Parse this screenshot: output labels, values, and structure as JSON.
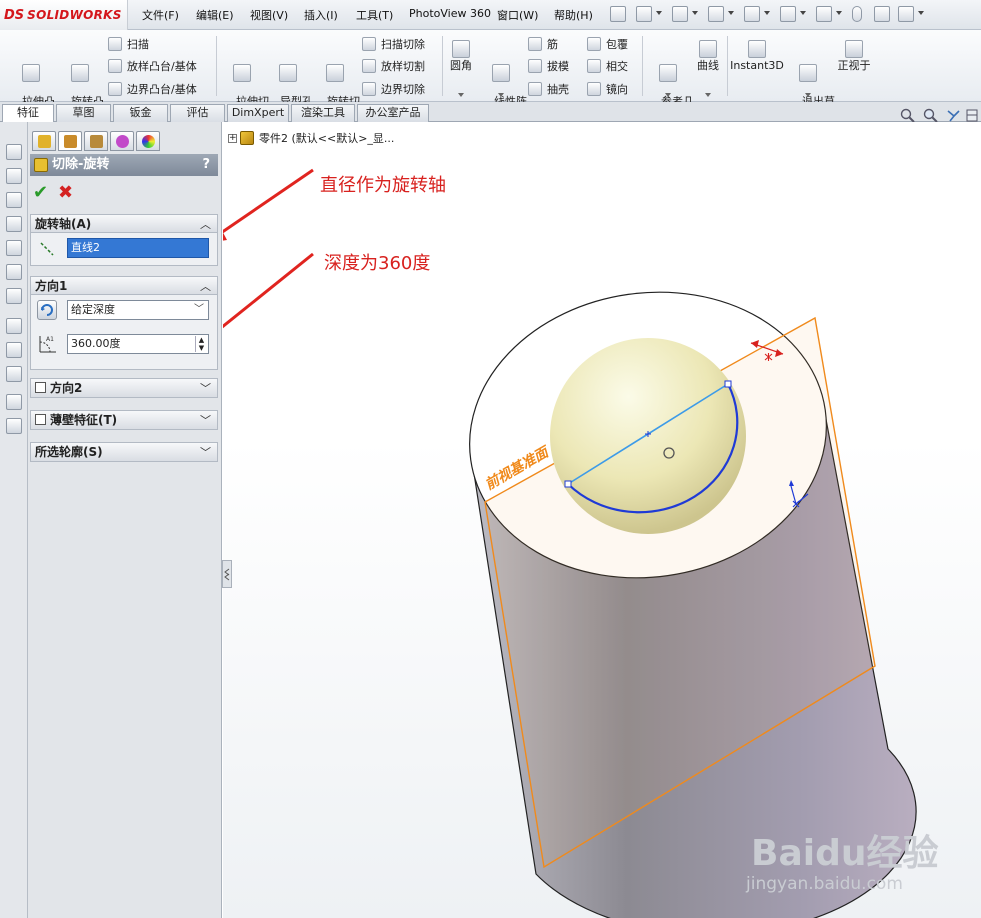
{
  "app": {
    "logo_mark": "DS",
    "brand": "SOLIDWORKS"
  },
  "menu": [
    "文件(F)",
    "编辑(E)",
    "视图(V)",
    "插入(I)",
    "工具(T)",
    "PhotoView 360",
    "窗口(W)",
    "帮助(H)"
  ],
  "commands": {
    "extrude_boss": "拉伸凸\n台/基体",
    "revolve_boss": "旋转凸\n台/基体",
    "sweep": "扫描",
    "loft_boss": "放样凸台/基体",
    "boundary_boss": "边界凸台/基体",
    "extrude_cut": "拉伸切\n除",
    "hole_wizard": "异型孔\n向导",
    "revolve_cut": "旋转切\n除",
    "swept_cut": "扫描切除",
    "lofted_cut": "放样切割",
    "boundary_cut": "边界切除",
    "fillet": "圆角",
    "linear_pattern": "线性阵\n列",
    "rib": "筋",
    "draft": "拔模",
    "shell": "抽壳",
    "wrap": "包覆",
    "intersect": "相交",
    "mirror": "镜向",
    "ref_geometry": "参考几\n何体",
    "curves": "曲线",
    "instant3d": "Instant3D",
    "exit_sketch": "退出草\n图",
    "normal_to": "正视于"
  },
  "tabs": [
    "特征",
    "草图",
    "钣金",
    "评估",
    "DimXpert",
    "渲染工具",
    "办公室产品"
  ],
  "property_manager": {
    "title": "切除-旋转",
    "help": "?",
    "ok_symbol": "✔",
    "cancel_symbol": "✖",
    "axis_group": {
      "label": "旋转轴(A)",
      "value": "直线2"
    },
    "direction1_group": {
      "label": "方向1",
      "end_condition": "给定深度",
      "angle": "360.00度"
    },
    "direction2_group": {
      "label": "方向2"
    },
    "thin_group": {
      "label": "薄壁特征(T)"
    },
    "contours_group": {
      "label": "所选轮廓(S)"
    }
  },
  "tree": {
    "expander": "+",
    "part_label": "零件2  (默认<<默认>_显..."
  },
  "annotations": {
    "axis_note": "直径作为旋转轴",
    "depth_note": "深度为360度"
  },
  "plane_label": "前视基准面",
  "watermark": {
    "brand": "Baidu经验",
    "url": "jingyan.baidu.com"
  },
  "colors": {
    "annotation": "#d8221f",
    "plane": "#f08a1c",
    "selection_blue": "#3478d4",
    "cylinder": "#9a97a6"
  }
}
